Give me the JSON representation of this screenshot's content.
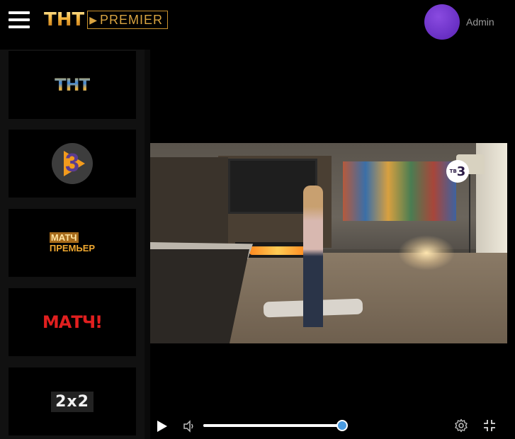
{
  "header": {
    "brand_tnt": "ТНТ",
    "brand_premier": "PREMIER",
    "user_name": "Admin"
  },
  "sidebar": {
    "channels": [
      {
        "id": "tnt",
        "logo_text": "ТНТ"
      },
      {
        "id": "tv3",
        "logo_text": "3"
      },
      {
        "id": "match-premier",
        "logo_line1": "МАТЧ",
        "logo_line2": "ПРЕМЬЕР"
      },
      {
        "id": "match",
        "logo_text": "МАТЧ!"
      },
      {
        "id": "2x2",
        "logo_text": "2x2"
      }
    ]
  },
  "player": {
    "channel_bug": {
      "prefix": "ТВ",
      "number": "3"
    },
    "progress": 1.0,
    "controls": [
      "play-icon",
      "volume-icon",
      "gear-icon",
      "exit-fullscreen-icon"
    ]
  },
  "colors": {
    "brand_gold": "#d9a441",
    "avatar": "#6d33c8",
    "seek_thumb": "#4a9be0",
    "match_red": "#e11f1f"
  }
}
